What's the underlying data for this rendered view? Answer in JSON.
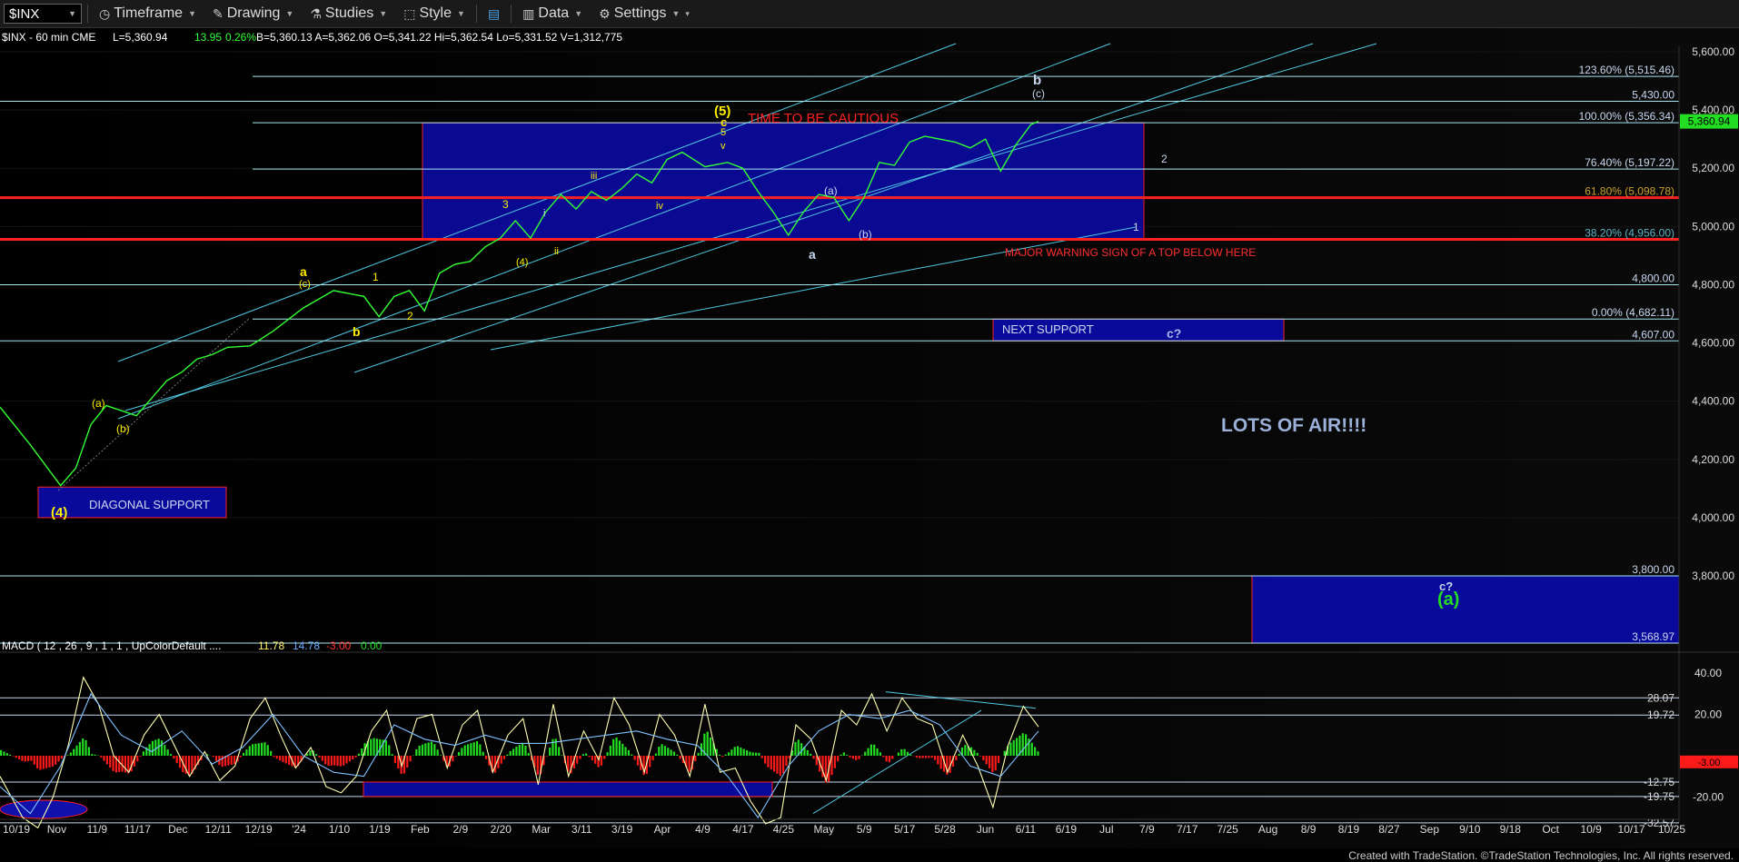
{
  "toolbar": {
    "symbol": "$INX",
    "timeframe": "Timeframe",
    "drawing": "Drawing",
    "studies": "Studies",
    "style": "Style",
    "data": "Data",
    "settings": "Settings"
  },
  "header": {
    "symbol_line": "$INX - 60 min  CME",
    "last": "L=5,360.94",
    "change": "13.95",
    "pct": "0.26%",
    "quotes": "B=5,360.13  A=5,362.06  O=5,341.22  Hi=5,362.54  Lo=5,331.52  V=1,312,775"
  },
  "colors": {
    "price": "#33ff33",
    "fib": "#a8e6f0",
    "channel": "#4fc8e0",
    "redline": "#ff2020",
    "box": "#0a0a9a",
    "wave_yellow": "#ffee00",
    "wave_white": "#c8d8f0",
    "macd_fast": "#ffffb0",
    "macd_slow": "#7ec0ff"
  },
  "chart_data": [
    {
      "type": "line",
      "title": "$INX - 60 min",
      "ylim": [
        3450,
        5720
      ],
      "y_ticks": [
        "5,600.00",
        "5,400.00",
        "5,200.00",
        "5,000.00",
        "4,800.00",
        "4,600.00",
        "4,400.00",
        "4,200.00",
        "4,000.00",
        "3,800.00"
      ],
      "x_labels": [
        "10/19",
        "Nov",
        "11/9",
        "11/17",
        "Dec",
        "12/11",
        "12/19",
        "'24",
        "1/10",
        "1/19",
        "Feb",
        "2/9",
        "2/20",
        "Mar",
        "3/11",
        "3/19",
        "Apr",
        "4/9",
        "4/17",
        "4/25",
        "May",
        "5/9",
        "5/17",
        "5/28",
        "Jun",
        "6/11",
        "6/19",
        "Jul",
        "7/9",
        "7/17",
        "7/25",
        "Aug",
        "8/9",
        "8/19",
        "8/27",
        "Sep",
        "9/10",
        "9/18",
        "Oct",
        "10/9",
        "10/17",
        "10/25"
      ],
      "price_series": {
        "name": "$INX",
        "t": [
          0,
          4,
          8,
          10,
          12,
          14,
          18,
          22,
          24,
          26,
          28,
          30,
          33,
          36,
          40,
          44,
          48,
          50,
          52,
          54,
          56,
          58,
          60,
          62,
          64,
          66,
          68,
          70,
          72,
          74,
          76,
          78,
          80,
          82,
          84,
          86,
          88,
          90,
          93,
          96,
          98,
          100,
          102,
          104,
          106,
          108,
          110,
          112,
          114,
          116,
          118,
          120,
          122,
          124,
          126,
          128,
          130,
          132,
          134,
          136,
          137
        ],
        "close": [
          4380,
          4250,
          4110,
          4170,
          4320,
          4385,
          4350,
          4470,
          4500,
          4545,
          4560,
          4585,
          4590,
          4640,
          4720,
          4780,
          4760,
          4690,
          4760,
          4780,
          4710,
          4840,
          4870,
          4880,
          4930,
          4960,
          5020,
          4960,
          5050,
          5110,
          5060,
          5120,
          5090,
          5130,
          5180,
          5150,
          5230,
          5255,
          5205,
          5220,
          5200,
          5120,
          5050,
          4970,
          5050,
          5110,
          5100,
          5020,
          5100,
          5220,
          5210,
          5290,
          5310,
          5300,
          5290,
          5270,
          5300,
          5190,
          5280,
          5350,
          5361
        ]
      },
      "levels": [
        {
          "price": 5430,
          "label": "5,430.00"
        },
        {
          "price": 5356.34,
          "label": "100.00% (5,356.34)"
        },
        {
          "price": 5515.46,
          "label": "123.60% (5,515.46)"
        },
        {
          "price": 5197.22,
          "label": "76.40% (5,197.22)"
        },
        {
          "price": 5098.78,
          "label": "61.80% (5,098.78)"
        },
        {
          "price": 4956,
          "label": "38.20% (4,956.00)"
        },
        {
          "price": 4800,
          "label": "4,800.00"
        },
        {
          "price": 4682.11,
          "label": "0.00% (4,682.11)"
        },
        {
          "price": 4607,
          "label": "4,607.00"
        },
        {
          "price": 3800,
          "label": "3,800.00"
        },
        {
          "price": 3568.97,
          "label": "3,568.97"
        }
      ],
      "current_price_label": "5,360.94",
      "annotations": {
        "time_cautious": "TIME TO BE CAUTIOUS",
        "major_warning": "MAJOR WARNING SIGN OF A TOP BELOW HERE",
        "next_support": "NEXT SUPPORT",
        "c_q": "c?",
        "lots_of_air": "LOTS OF AIR!!!!",
        "diagonal_support": "DIAGONAL SUPPORT",
        "bottom_cq": "c?",
        "bottom_a": "(a)",
        "wave_5": "(5)",
        "wave_c": "c",
        "wave_4": "(4)",
        "wave_b": "b",
        "wave_c_paren": "(c)",
        "wave_1": "1",
        "wave_2": "2",
        "wave_3": "3",
        "wave_a": "a",
        "wave_a_paren": "(a)",
        "wave_b_paren": "(b)",
        "wave_i": "i",
        "wave_ii": "ii",
        "wave_iii": "iii",
        "wave_iv": "iv",
        "wave_v": "v",
        "wave_5_small": "5"
      }
    },
    {
      "type": "line",
      "title": "MACD ( 12 , 26 , 9 , 1 , 1 , UpColorDefault ....",
      "values_text": [
        "11.78",
        "14.78",
        "-3.00",
        "0.00"
      ],
      "ylim": [
        -40,
        45
      ],
      "y_ticks": [
        "40.00",
        "20.00",
        "-20.00"
      ],
      "levels": [
        {
          "value": 28.07,
          "label": "28.07"
        },
        {
          "value": 19.72,
          "label": "19.72"
        },
        {
          "value": -12.75,
          "label": "-12.75"
        },
        {
          "value": -19.75,
          "label": "-19.75"
        },
        {
          "value": -32.57,
          "label": "-32.57"
        }
      ],
      "current_label": "-3.00",
      "series": [
        {
          "t": [
            0,
            3,
            5,
            7,
            9,
            11,
            13,
            15,
            17,
            19,
            21,
            23,
            25,
            27,
            29,
            31,
            33,
            35,
            37,
            39,
            41,
            43,
            45,
            47,
            49,
            51,
            53,
            55,
            57,
            59,
            61,
            63,
            65,
            67,
            69,
            71,
            73,
            75,
            77,
            79,
            81,
            83,
            85,
            87,
            89,
            91,
            93,
            95,
            97,
            99,
            101,
            103,
            105,
            107,
            109,
            111,
            113,
            115,
            117,
            119,
            121,
            123,
            125,
            127,
            129,
            131,
            133,
            135,
            137
          ],
          "values": [
            -10,
            -30,
            -35,
            -20,
            5,
            38,
            25,
            0,
            -8,
            10,
            20,
            5,
            -10,
            2,
            -12,
            -5,
            18,
            28,
            10,
            -6,
            4,
            -15,
            -18,
            -10,
            12,
            22,
            -5,
            18,
            20,
            -6,
            15,
            22,
            -8,
            10,
            18,
            -14,
            25,
            -10,
            12,
            -2,
            28,
            15,
            -8,
            20,
            10,
            -10,
            25,
            -8,
            -6,
            -22,
            -33,
            -30,
            15,
            8,
            -12,
            22,
            15,
            30,
            12,
            28,
            18,
            15,
            -8,
            10,
            -5,
            -25,
            5,
            24,
            14
          ]
        },
        {
          "t": [
            0,
            4,
            8,
            12,
            16,
            20,
            24,
            28,
            32,
            36,
            40,
            44,
            48,
            52,
            56,
            60,
            64,
            68,
            72,
            76,
            80,
            84,
            88,
            92,
            96,
            100,
            104,
            108,
            112,
            116,
            120,
            124,
            128,
            132,
            137
          ],
          "values": [
            -15,
            -28,
            -5,
            30,
            10,
            2,
            12,
            -4,
            4,
            20,
            0,
            -8,
            -10,
            15,
            8,
            5,
            10,
            6,
            6,
            8,
            10,
            12,
            8,
            5,
            -10,
            -30,
            -5,
            12,
            20,
            18,
            22,
            15,
            -5,
            -10,
            12
          ]
        }
      ]
    }
  ],
  "footer": "Created with TradeStation. ©TradeStation Technologies, Inc. All rights reserved."
}
